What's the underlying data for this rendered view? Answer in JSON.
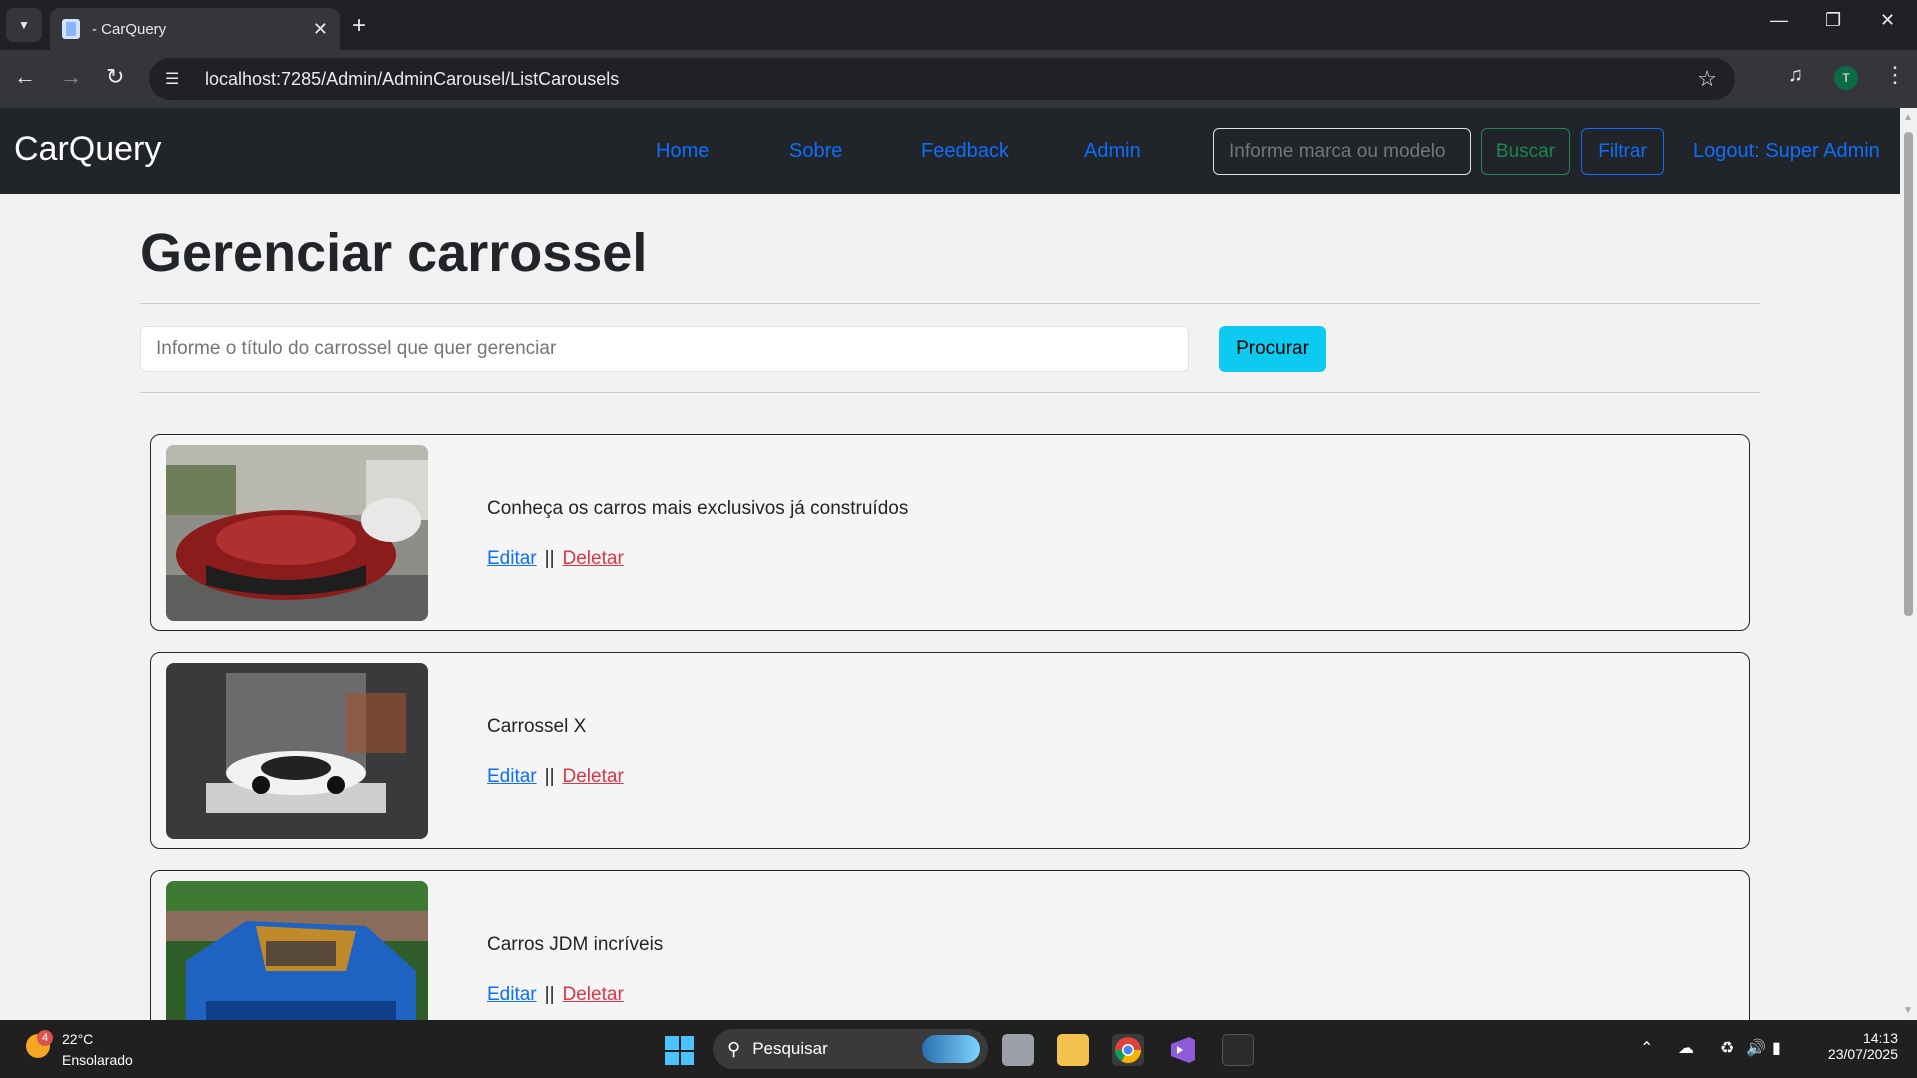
{
  "browser": {
    "tab_title": "- CarQuery",
    "url": "localhost:7285/Admin/AdminCarousel/ListCarousels",
    "profile_initial": "T"
  },
  "navbar": {
    "brand": "CarQuery",
    "links": [
      "Home",
      "Sobre",
      "Feedback",
      "Admin"
    ],
    "search_placeholder": "Informe marca ou modelo",
    "buscar_label": "Buscar",
    "filtrar_label": "Filtrar",
    "logout_label": "Logout: Super Admin"
  },
  "main": {
    "title": "Gerenciar carrossel",
    "search_placeholder": "Informe o título do carrossel que quer gerenciar",
    "search_button": "Procurar",
    "carousels": [
      {
        "title": "Conheça os carros mais exclusivos já construídos",
        "edit": "Editar",
        "separator": "||",
        "delete": "Deletar"
      },
      {
        "title": "Carrossel X",
        "edit": "Editar",
        "separator": "||",
        "delete": "Deletar"
      },
      {
        "title": "Carros JDM incríveis",
        "edit": "Editar",
        "separator": "||",
        "delete": "Deletar"
      }
    ]
  },
  "taskbar": {
    "temperature": "22°C",
    "weather": "Ensolarado",
    "weather_badge": "4",
    "search_label": "Pesquisar",
    "time": "14:13",
    "date": "23/07/2025"
  },
  "colors": {
    "navbar_bg": "#212529",
    "link": "#0d6efd",
    "success": "#198754",
    "info": "#0dcaf0",
    "danger": "#dc3545"
  }
}
